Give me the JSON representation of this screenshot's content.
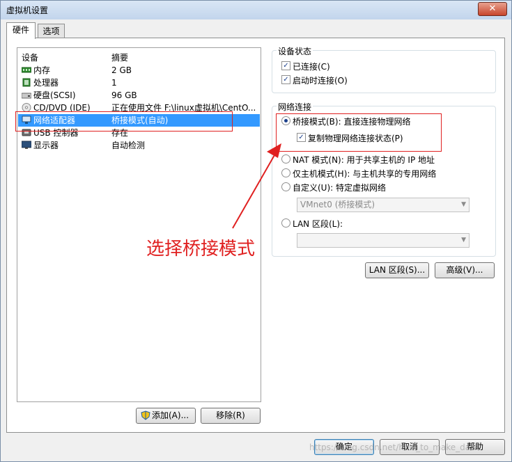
{
  "window": {
    "title": "虚拟机设置",
    "close_glyph": "✕"
  },
  "tabs": [
    {
      "label": "硬件",
      "active": true
    },
    {
      "label": "选项",
      "active": false
    }
  ],
  "device_list": {
    "headers": {
      "device": "设备",
      "summary": "摘要"
    },
    "rows": [
      {
        "icon": "memory-icon",
        "name": "内存",
        "summary": "2 GB"
      },
      {
        "icon": "processor-icon",
        "name": "处理器",
        "summary": "1"
      },
      {
        "icon": "harddisk-icon",
        "name": "硬盘(SCSI)",
        "summary": "96 GB"
      },
      {
        "icon": "cdrom-icon",
        "name": "CD/DVD (IDE)",
        "summary": "正在使用文件 F:\\linux虚拟机\\CentO..."
      },
      {
        "icon": "network-adapter-icon",
        "name": "网络适配器",
        "summary": "桥接模式(自动)",
        "selected": true
      },
      {
        "icon": "usb-icon",
        "name": "USB 控制器",
        "summary": "存在"
      },
      {
        "icon": "display-icon",
        "name": "显示器",
        "summary": "自动检测"
      }
    ]
  },
  "device_buttons": {
    "add": "添加(A)...",
    "remove": "移除(R)"
  },
  "device_status": {
    "title": "设备状态",
    "connected": {
      "label": "已连接(C)",
      "checked": true
    },
    "connect_at_power_on": {
      "label": "启动时连接(O)",
      "checked": true
    }
  },
  "network_connection": {
    "title": "网络连接",
    "bridged": {
      "label": "桥接模式(B): 直接连接物理网络",
      "selected": true
    },
    "replicate": {
      "label": "复制物理网络连接状态(P)",
      "checked": true
    },
    "nat": {
      "label": "NAT 模式(N): 用于共享主机的 IP 地址",
      "selected": false
    },
    "host_only": {
      "label": "仅主机模式(H): 与主机共享的专用网络",
      "selected": false
    },
    "custom": {
      "label": "自定义(U): 特定虚拟网络",
      "selected": false
    },
    "custom_select": {
      "value": "VMnet0 (桥接模式)"
    },
    "lan_segment": {
      "label": "LAN 区段(L):",
      "selected": false
    },
    "lan_select": {
      "value": ""
    }
  },
  "adapter_buttons": {
    "lan_segments": "LAN 区段(S)...",
    "advanced": "高级(V)..."
  },
  "dialog_buttons": {
    "ok": "确定",
    "cancel": "取消",
    "help": "帮助"
  },
  "annotation": {
    "text": "选择桥接模式"
  },
  "watermark": {
    "text": "https://blog.csdn.net/how_to_make_data"
  },
  "colors": {
    "selection": "#3399ff",
    "annotation": "#e02020"
  }
}
